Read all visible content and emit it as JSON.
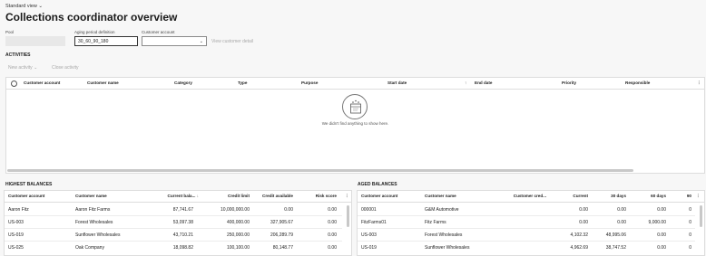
{
  "header": {
    "view_label": "Standard view",
    "view_chevron": "chevron-down-icon",
    "title": "Collections coordinator overview"
  },
  "filters": {
    "pool_label": "Pool",
    "pool_value": "",
    "aging_label": "Aging period definition",
    "aging_value": "30_60_90_180",
    "customer_label": "Customer account",
    "customer_value": "",
    "view_customer_detail": "View customer detail"
  },
  "activities": {
    "section_title": "ACTIVITIES",
    "new_activity": "New activity",
    "close_activity": "Close activity",
    "columns": [
      "Customer account",
      "Customer name",
      "Category",
      "Type",
      "Purpose",
      "Start date",
      "End date",
      "Priority",
      "Responsible"
    ],
    "empty_message": "We didn't find anything to show here."
  },
  "highest_balances": {
    "section_title": "HIGHEST BALANCES",
    "columns": [
      "Customer account",
      "Customer name",
      "Current bala...",
      "Credit limit",
      "Credit available",
      "Risk score"
    ],
    "rows": [
      [
        "Aaron Fitz",
        "Aaron Fitz Farms",
        "87,741.67",
        "10,000,000.00",
        "0.00",
        "0.00"
      ],
      [
        "US-003",
        "Forest Wholesales",
        "53,097.38",
        "400,000.00",
        "327,905.67",
        "0.00"
      ],
      [
        "US-019",
        "Sunflower Wholesales",
        "43,710.21",
        "250,000.00",
        "206,289.79",
        "0.00"
      ],
      [
        "US-025",
        "Oak Company",
        "18,098.82",
        "100,100.00",
        "80,148.77",
        "0.00"
      ]
    ]
  },
  "aged_balances": {
    "section_title": "AGED BALANCES",
    "columns": [
      "Customer account",
      "Customer name",
      "Customer cred...",
      "Current",
      "30 days",
      "60 days",
      "90"
    ],
    "rows": [
      [
        "000001",
        "G&M Automotive",
        "",
        "0.00",
        "0.00",
        "0.00",
        "0"
      ],
      [
        "FitzFarms01",
        "Fitz Farms",
        "",
        "0.00",
        "0.00",
        "9,000.00",
        "0"
      ],
      [
        "US-003",
        "Forest Wholesales",
        "",
        "4,102.32",
        "48,995.06",
        "0.00",
        "0"
      ],
      [
        "US-019",
        "Sunflower Wholesales",
        "",
        "4,962.69",
        "38,747.52",
        "0.00",
        "0"
      ]
    ]
  },
  "colors": {
    "background": "#f7f7f7",
    "panel": "#ffffff",
    "disabled_text": "#a8a8a8"
  }
}
